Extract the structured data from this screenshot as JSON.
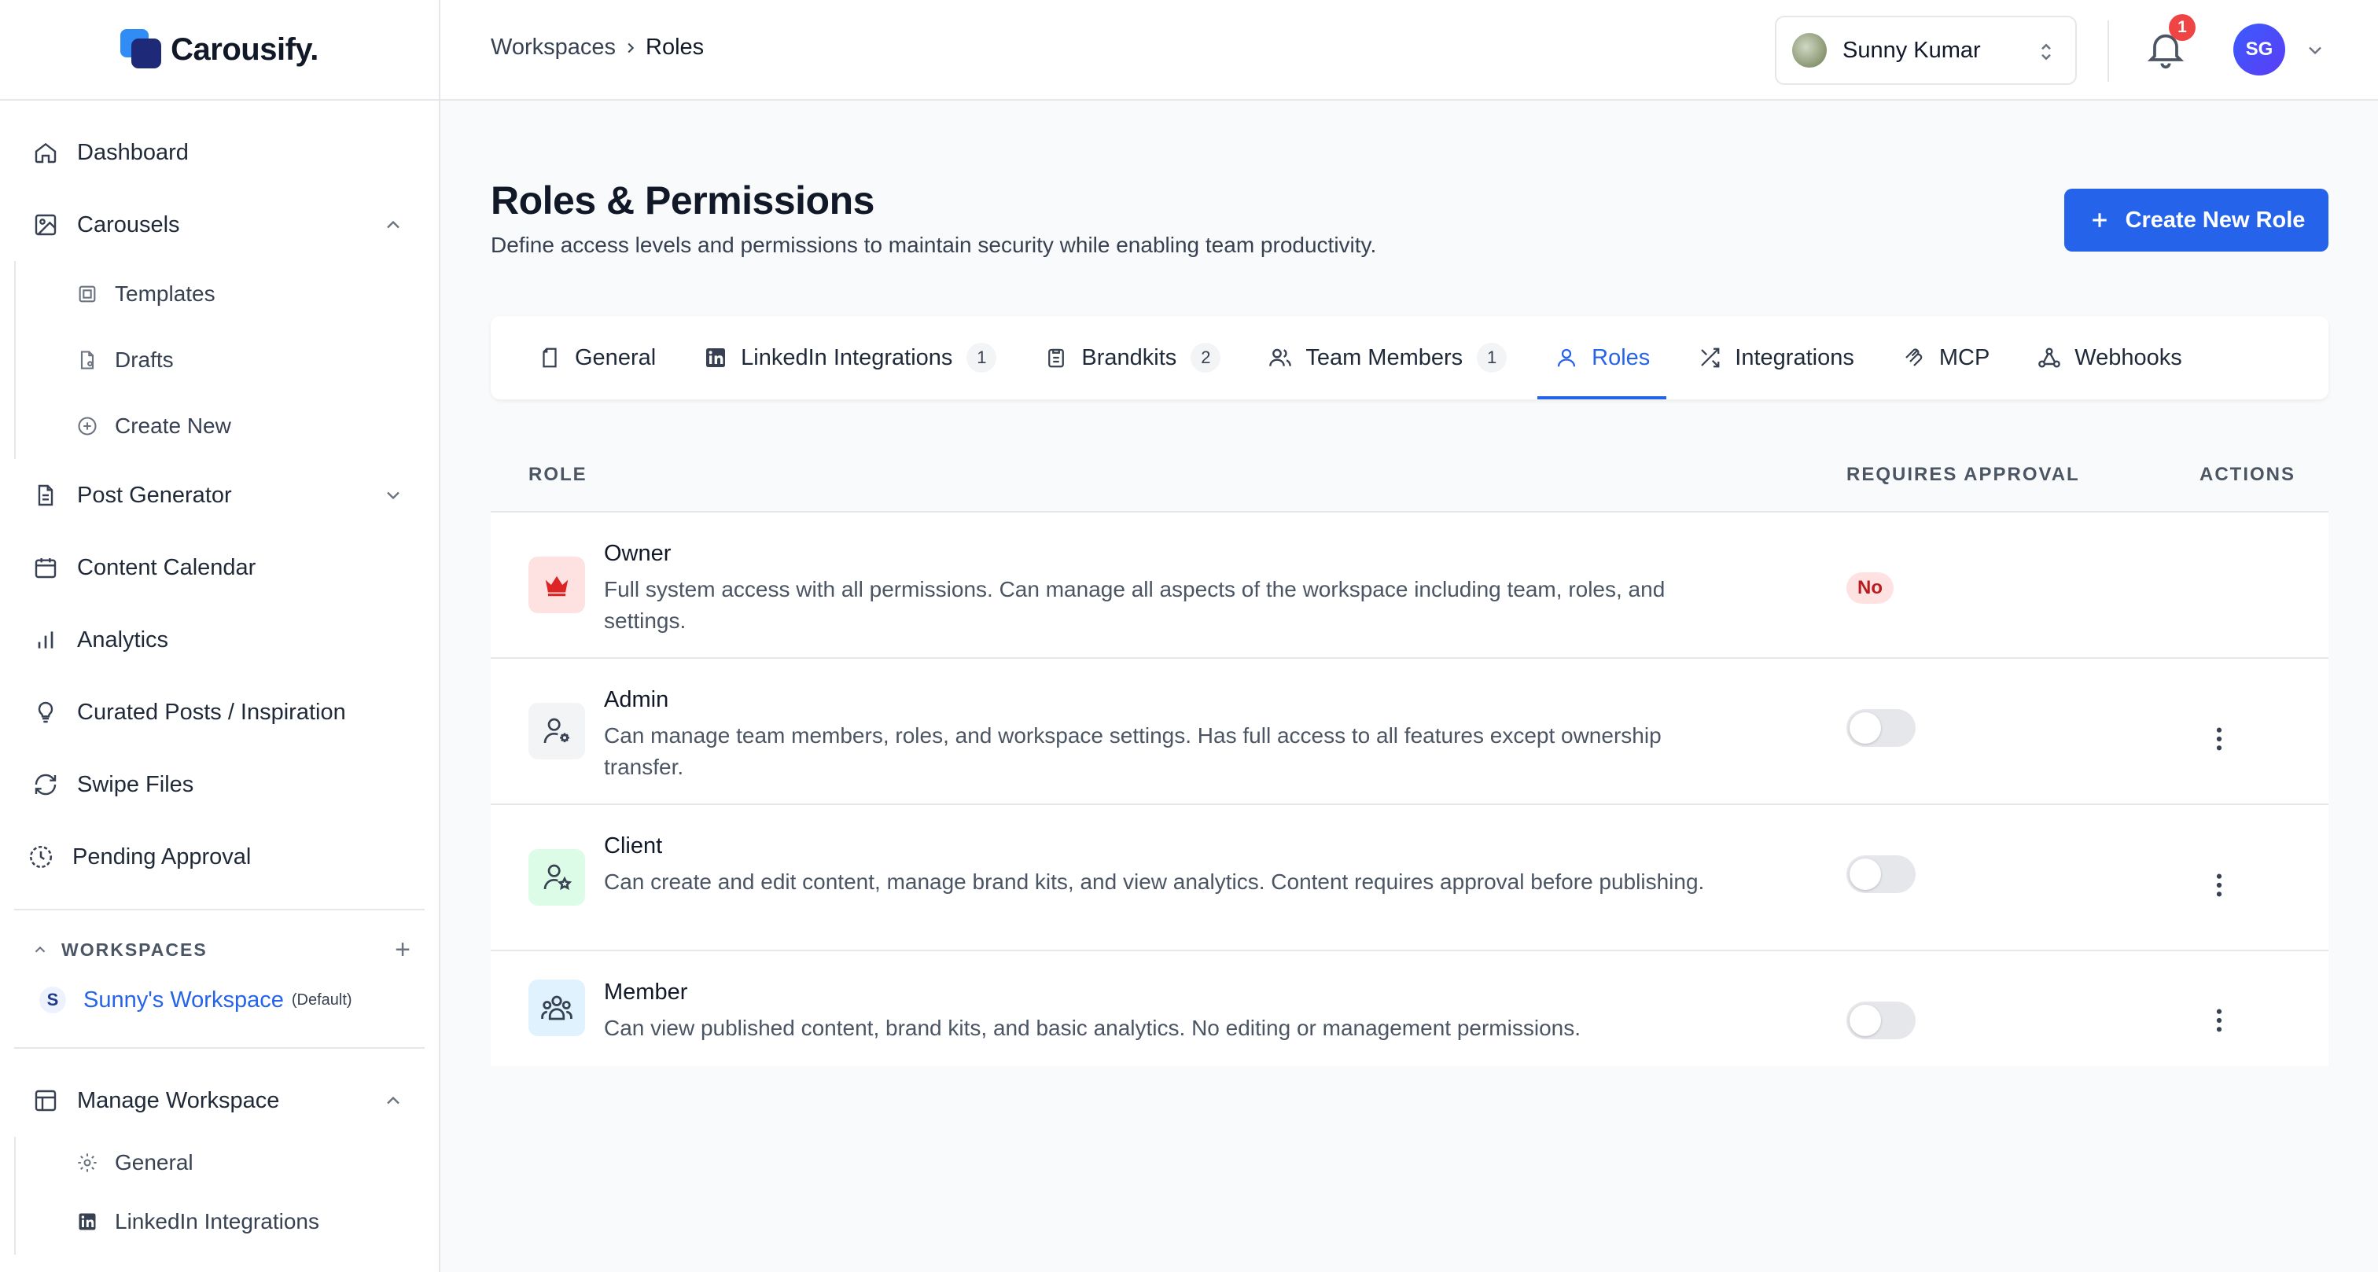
{
  "app": {
    "name": "Carousify."
  },
  "sidebar": {
    "items": [
      {
        "label": "Dashboard",
        "icon": "home-icon"
      },
      {
        "label": "Carousels",
        "icon": "image-icon",
        "expanded": true,
        "children": [
          {
            "label": "Templates",
            "icon": "template-icon"
          },
          {
            "label": "Drafts",
            "icon": "draft-icon"
          },
          {
            "label": "Create New",
            "icon": "plus-circle-icon"
          }
        ]
      },
      {
        "label": "Post Generator",
        "icon": "document-icon",
        "expanded": false
      },
      {
        "label": "Content Calendar",
        "icon": "calendar-icon"
      },
      {
        "label": "Analytics",
        "icon": "bar-chart-icon"
      },
      {
        "label": "Curated Posts / Inspiration",
        "icon": "lightbulb-icon"
      },
      {
        "label": "Swipe Files",
        "icon": "refresh-icon"
      },
      {
        "label": "Pending Approval",
        "icon": "clock-dashed-icon"
      }
    ],
    "workspaces": {
      "heading": "WORKSPACES",
      "items": [
        {
          "initial": "S",
          "name": "Sunny's Workspace",
          "tag": "(Default)"
        }
      ]
    },
    "manage": {
      "label": "Manage Workspace",
      "children": [
        {
          "label": "General",
          "icon": "gear-icon"
        },
        {
          "label": "LinkedIn Integrations",
          "icon": "linkedin-icon"
        }
      ]
    }
  },
  "topbar": {
    "breadcrumb": [
      "Workspaces",
      "Roles"
    ],
    "user": {
      "name": "Sunny Kumar"
    },
    "notifications": {
      "count": "1"
    },
    "avatar_initials": "SG"
  },
  "page": {
    "title": "Roles & Permissions",
    "subtitle": "Define access levels and permissions to maintain security while enabling team productivity.",
    "create_button": "Create New Role"
  },
  "tabs": [
    {
      "label": "General",
      "icon": "file-icon",
      "count": null,
      "active": false
    },
    {
      "label": "LinkedIn Integrations",
      "icon": "linkedin-icon",
      "count": "1",
      "active": false
    },
    {
      "label": "Brandkits",
      "icon": "clipboard-icon",
      "count": "2",
      "active": false
    },
    {
      "label": "Team Members",
      "icon": "users-icon",
      "count": "1",
      "active": false
    },
    {
      "label": "Roles",
      "icon": "user-icon",
      "count": null,
      "active": true
    },
    {
      "label": "Integrations",
      "icon": "shuffle-icon",
      "count": null,
      "active": false
    },
    {
      "label": "MCP",
      "icon": "mcp-icon",
      "count": null,
      "active": false
    },
    {
      "label": "Webhooks",
      "icon": "webhook-icon",
      "count": null,
      "active": false
    }
  ],
  "table": {
    "headers": {
      "role": "ROLE",
      "approval": "REQUIRES APPROVAL",
      "actions": "ACTIONS"
    },
    "rows": [
      {
        "name": "Owner",
        "description": "Full system access with all permissions. Can manage all aspects of the workspace including team, roles, and settings.",
        "approval": "No",
        "icon": "crown-icon",
        "icon_bg": "#fee2e2",
        "icon_color": "#dc2626"
      },
      {
        "name": "Admin",
        "description": "Can manage team members, roles, and workspace settings. Has full access to all features except ownership transfer.",
        "approval": "off",
        "icon": "user-gear-icon",
        "icon_bg": "#f3f4f6",
        "icon_color": "#374151"
      },
      {
        "name": "Client",
        "description": "Can create and edit content, manage brand kits, and view analytics. Content requires approval before publishing.",
        "approval": "off",
        "icon": "user-star-icon",
        "icon_bg": "#dcfce7",
        "icon_color": "#374151"
      },
      {
        "name": "Member",
        "description": "Can view published content, brand kits, and basic analytics. No editing or management permissions.",
        "approval": "off",
        "icon": "users-group-icon",
        "icon_bg": "#e0f2fe",
        "icon_color": "#374151"
      }
    ]
  },
  "colors": {
    "accent": "#2563eb",
    "danger": "#ef4444"
  }
}
